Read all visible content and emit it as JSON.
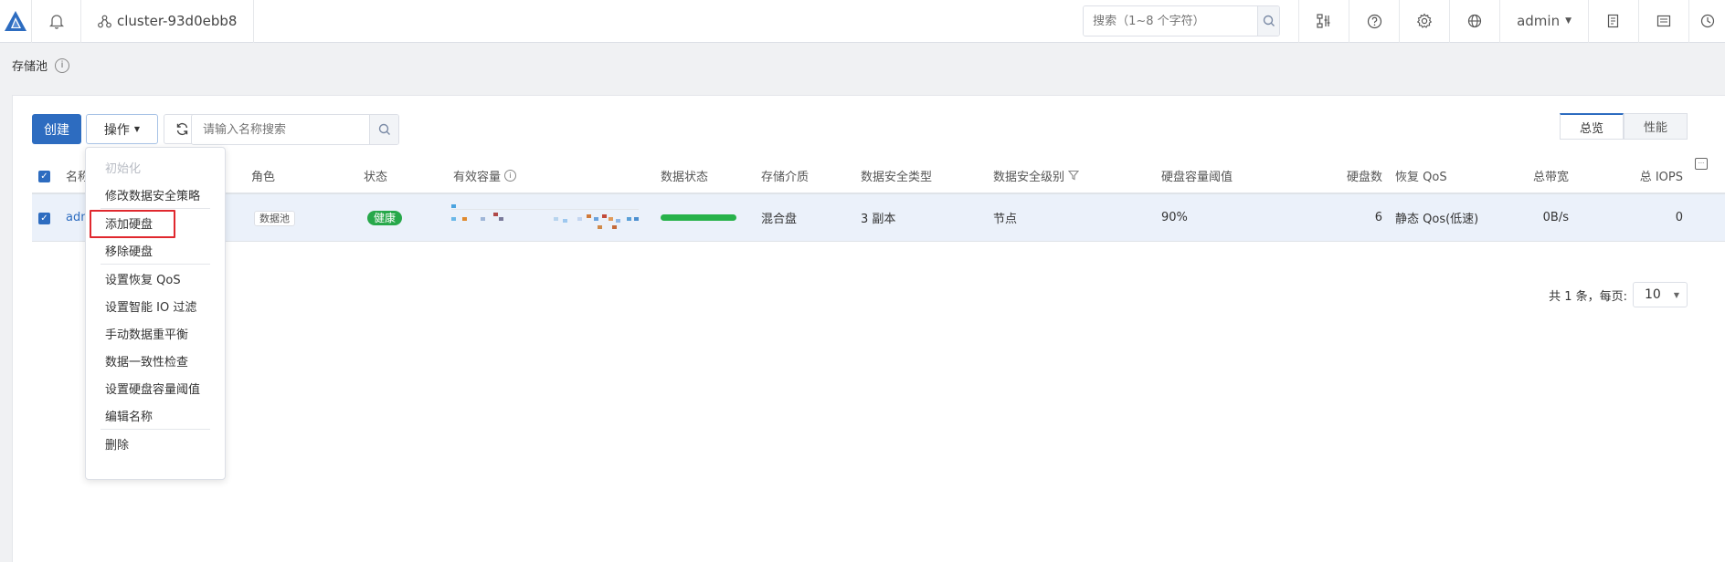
{
  "topbar": {
    "cluster_name": "cluster-93d0ebb8",
    "search_placeholder": "搜索（1~8 个字符）",
    "user": "admin"
  },
  "page": {
    "title": "存储池"
  },
  "toolbar": {
    "create_label": "创建",
    "ops_label": "操作",
    "name_search_placeholder": "请输入名称搜索"
  },
  "view_tabs": [
    {
      "label": "总览",
      "active": true
    },
    {
      "label": "性能",
      "active": false
    }
  ],
  "table": {
    "headers": {
      "name": "名称",
      "role": "角色",
      "status": "状态",
      "capacity": "有效容量",
      "data_status": "数据状态",
      "media": "存储介质",
      "safety_type": "数据安全类型",
      "safety_level": "数据安全级别",
      "threshold": "硬盘容量阈值",
      "disk_count": "硬盘数",
      "recovery_qos": "恢复 QoS",
      "bandwidth": "总带宽",
      "iops": "总 IOPS"
    },
    "rows": [
      {
        "name": "adm",
        "role": "数据池",
        "status": "健康",
        "data_status_progress": 1.0,
        "media": "混合盘",
        "safety_type": "3 副本",
        "safety_level": "节点",
        "threshold": "90%",
        "disk_count": "6",
        "recovery_qos": "静态 Qos(低速)",
        "bandwidth": "0B/s",
        "iops": "0"
      }
    ]
  },
  "pager": {
    "summary": "共 1 条，每页:",
    "page_size": "10"
  },
  "ops_menu": [
    {
      "label": "初始化",
      "disabled": true
    },
    {
      "label": "修改数据安全策略"
    },
    {
      "sep": true
    },
    {
      "label": "添加硬盘",
      "highlight": true
    },
    {
      "label": "移除硬盘"
    },
    {
      "sep": true
    },
    {
      "label": "设置恢复 QoS"
    },
    {
      "label": "设置智能 IO 过滤"
    },
    {
      "label": "手动数据重平衡"
    },
    {
      "label": "数据一致性检查"
    },
    {
      "label": "设置硬盘容量阈值"
    },
    {
      "label": "编辑名称"
    },
    {
      "sep": true
    },
    {
      "label": "删除"
    }
  ],
  "colors": {
    "primary": "#2d6cc0",
    "healthy": "#27a84a",
    "highlight_border": "#e0282e"
  }
}
